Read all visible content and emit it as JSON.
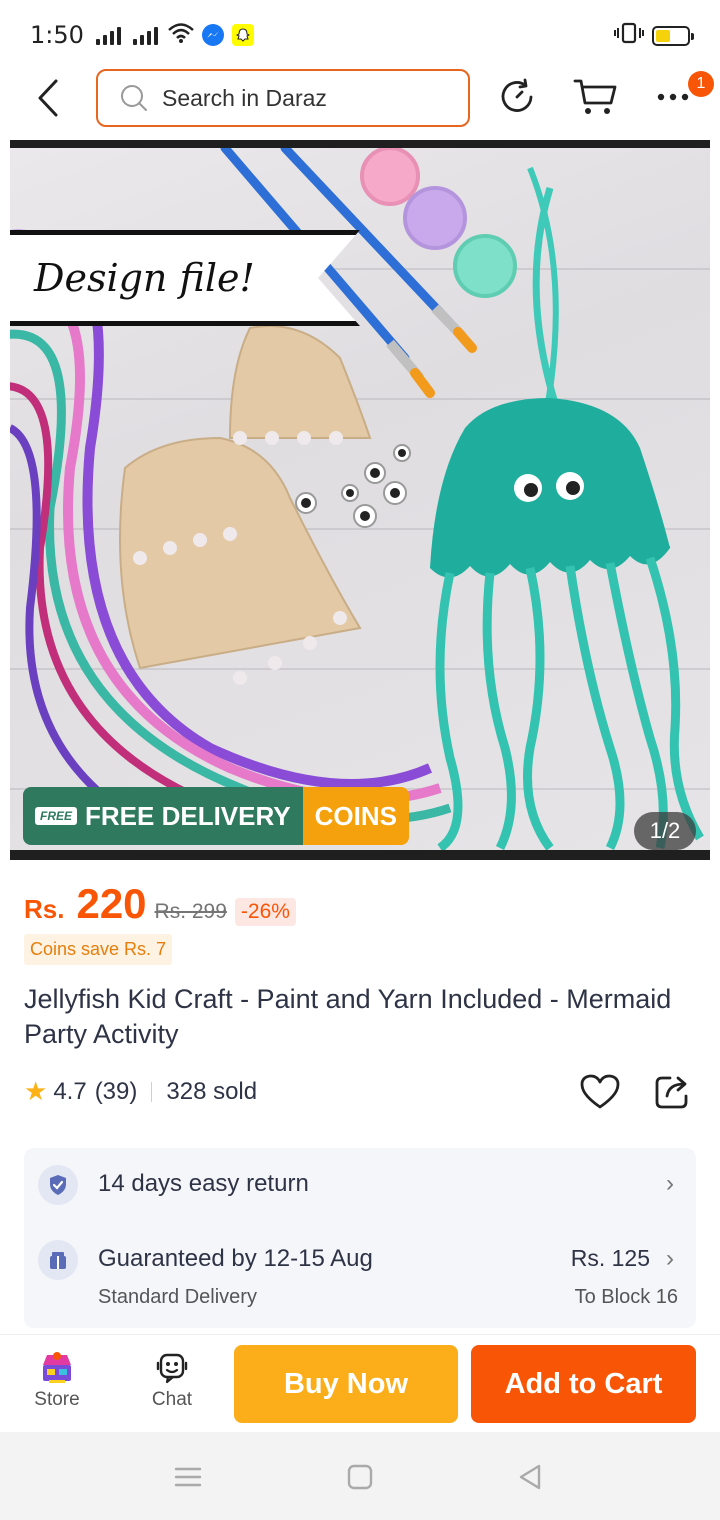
{
  "status_bar": {
    "time": "1:50"
  },
  "header": {
    "search_placeholder": "Search in Daraz",
    "more_badge_count": "1"
  },
  "product_image": {
    "banner_text": "Design file!",
    "free_delivery_label": "FREE DELIVERY",
    "free_truck_label": "FREE",
    "coins_label": "COINS",
    "counter": "1/2"
  },
  "price": {
    "currency": "Rs.",
    "current": "220",
    "original": "Rs. 299",
    "discount": "-26%",
    "coins_save": "Coins save Rs. 7"
  },
  "product": {
    "title": "Jellyfish Kid Craft - Paint and Yarn Included - Mermaid Party Activity",
    "rating": "4.7",
    "review_count": "(39)",
    "sold": "328 sold"
  },
  "services": {
    "return_policy": "14 days easy return",
    "delivery_guarantee": "Guaranteed by 12-15 Aug",
    "delivery_type": "Standard Delivery",
    "delivery_price": "Rs. 125",
    "delivery_destination": "To Block 16"
  },
  "action_bar": {
    "store_label": "Store",
    "chat_label": "Chat",
    "buy_now_label": "Buy Now",
    "add_to_cart_label": "Add to Cart"
  },
  "colors": {
    "brand_orange": "#f85606",
    "buy_now_yellow": "#fbad1a",
    "free_delivery_green": "#2f7a5e",
    "coins_gold": "#f5a10d"
  }
}
